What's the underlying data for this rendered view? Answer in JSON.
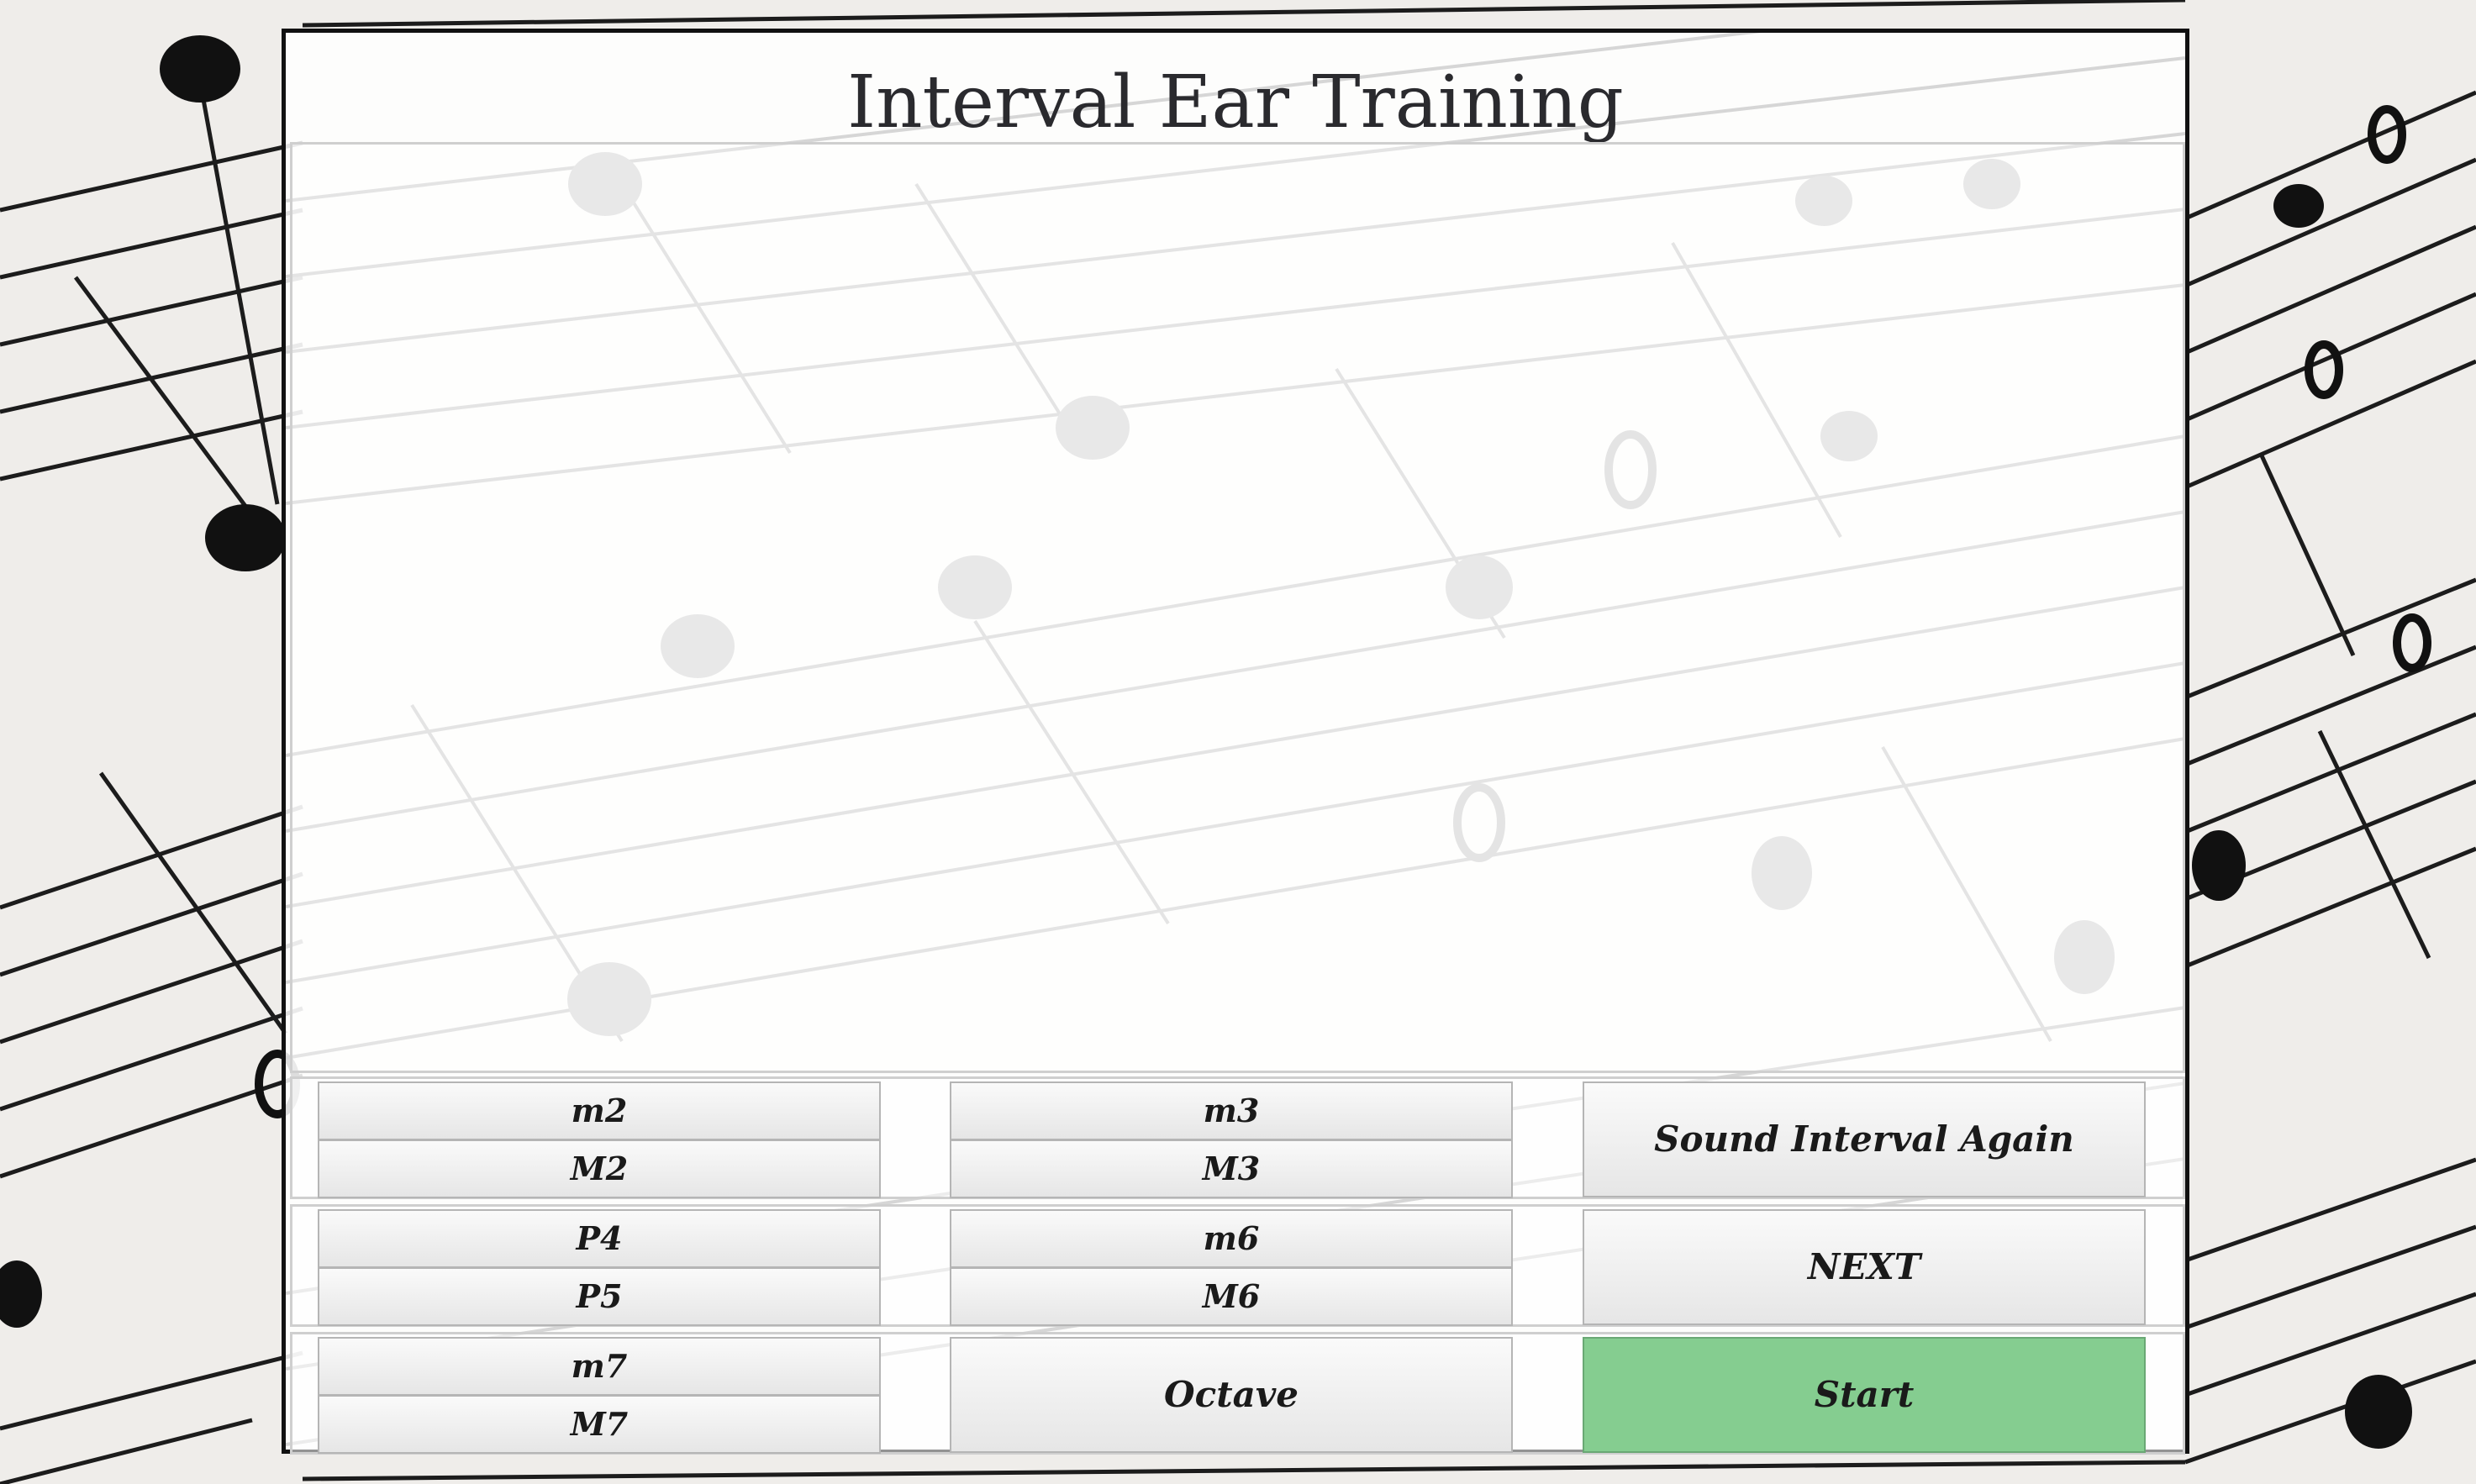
{
  "app": {
    "title": "Interval Ear Training"
  },
  "buttons": {
    "row1": {
      "m2": "m2",
      "M2": "M2",
      "m3": "m3",
      "M3": "M3",
      "sound_again": "Sound Interval Again"
    },
    "row2": {
      "P4": "P4",
      "P5": "P5",
      "m6": "m6",
      "M6": "M6",
      "next": "NEXT"
    },
    "row3": {
      "m7": "m7",
      "M7": "M7",
      "octave": "Octave",
      "start": "Start"
    }
  },
  "colors": {
    "start_button": "#85cd90",
    "panel_border": "#111111",
    "button_face": "#eeeeee",
    "title_text": "#2a2a2e"
  },
  "background": {
    "theme": "sheet-music-notes"
  }
}
